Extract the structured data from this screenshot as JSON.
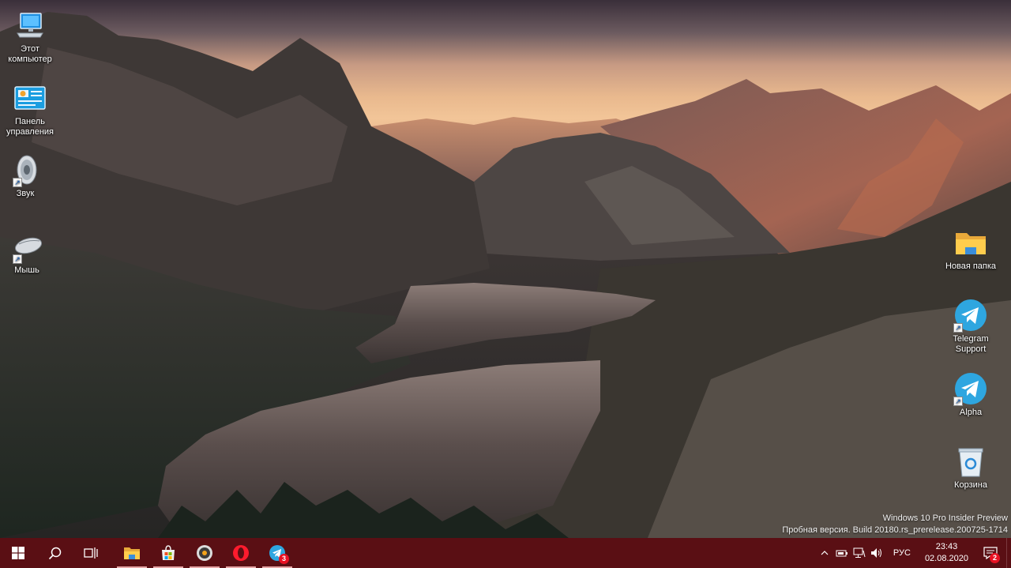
{
  "desktop": {
    "icons_left": [
      {
        "label": "Этот\nкомпьютер",
        "icon": "computer-icon"
      },
      {
        "label": "Панель\nуправления",
        "icon": "control-panel-icon"
      },
      {
        "label": "Звук",
        "icon": "speaker-icon"
      },
      {
        "label": "Мышь",
        "icon": "mouse-icon"
      }
    ],
    "icons_right": [
      {
        "label": "Новая папка",
        "icon": "folder-icon"
      },
      {
        "label": "Telegram\nSupport",
        "icon": "telegram-icon"
      },
      {
        "label": "Alpha",
        "icon": "telegram-icon"
      },
      {
        "label": "Корзина",
        "icon": "recycle-bin-icon"
      }
    ]
  },
  "watermark": {
    "line1": "Windows 10 Pro Insider Preview",
    "line2": "Пробная версия. Build 20180.rs_prerelease.200725-1714"
  },
  "taskbar": {
    "apps": [
      {
        "name": "start",
        "icon": "windows-icon"
      },
      {
        "name": "search",
        "icon": "search-icon"
      },
      {
        "name": "task-view",
        "icon": "task-view-icon"
      },
      {
        "name": "file-explorer",
        "icon": "folder-icon",
        "active": true
      },
      {
        "name": "store",
        "icon": "store-icon",
        "active": true
      },
      {
        "name": "media",
        "icon": "disc-icon",
        "active": true
      },
      {
        "name": "opera",
        "icon": "opera-icon",
        "active": true
      },
      {
        "name": "telegram",
        "icon": "telegram-icon",
        "active": true,
        "badge": "3"
      }
    ],
    "tray": {
      "language": "РУС",
      "time": "23:43",
      "date": "02.08.2020",
      "notification_count": "2"
    }
  },
  "colors": {
    "taskbar": "#5a0f14",
    "accent_underline": "#e7a7a7",
    "badge": "#e81123"
  }
}
